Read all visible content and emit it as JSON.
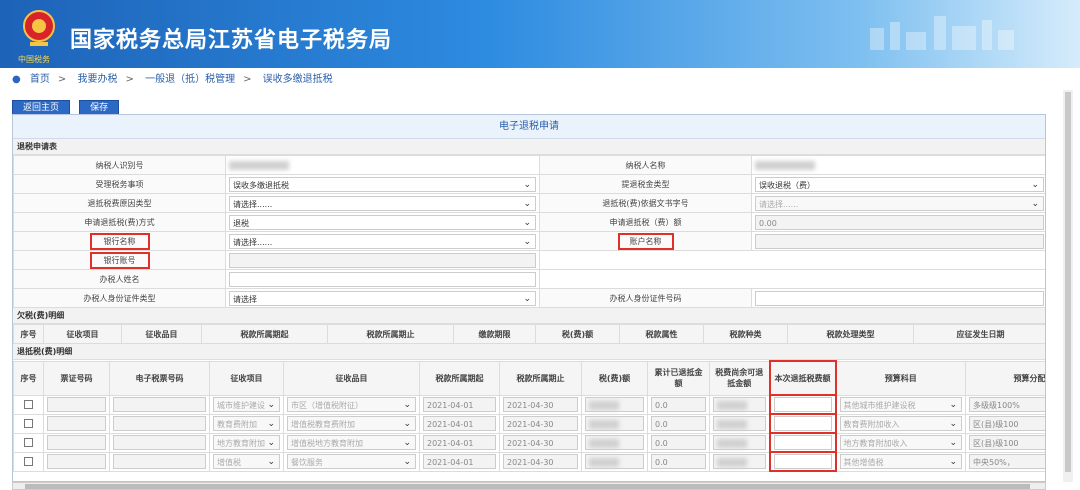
{
  "header": {
    "title": "国家税务总局江苏省电子税务局",
    "tagline": "中国税务"
  },
  "breadcrumb": [
    "首页",
    "我要办税",
    "一般退（抵）税管理",
    "误收多缴退抵税"
  ],
  "toolbar": {
    "back_label": "返回主页",
    "save_label": "保存"
  },
  "panel_title": "电子退税申请",
  "sections": {
    "apply": "退税申请表",
    "owed": "欠税(费)明细",
    "refund": "退抵税(费)明细"
  },
  "form": {
    "taxpayer_id_label": "纳税人识别号",
    "taxpayer_name_label": "纳税人名称",
    "matter_label": "受理税务事项",
    "matter_value": "误收多缴退抵税",
    "fund_type_label": "提退税金类型",
    "fund_type_value": "误收退税（费）",
    "reason_label": "退抵税费原因类型",
    "reason_value": "请选择......",
    "doc_no_label": "退抵税(费)依据文书字号",
    "doc_no_value": "请选择......",
    "method_label": "申请退抵税(费)方式",
    "method_value": "退税",
    "amount_label": "申请退抵税（费）额",
    "amount_value": "0.00",
    "bank_name_label": "银行名称",
    "bank_name_value": "请选择......",
    "account_name_label": "账户名称",
    "bank_account_label": "银行账号",
    "agent_name_label": "办税人姓名",
    "agent_idtype_label": "办税人身份证件类型",
    "agent_idtype_value": "请选择",
    "agent_idno_label": "办税人身份证件号码"
  },
  "owed_columns": [
    "序号",
    "征收项目",
    "征收品目",
    "税款所属期起",
    "税款所属期止",
    "缴款期限",
    "税(费)额",
    "税款属性",
    "税款种类",
    "税款处理类型",
    "应征发生日期"
  ],
  "refund_columns": [
    "序号",
    "票证号码",
    "电子税票号码",
    "征收项目",
    "征收品目",
    "税款所属期起",
    "税款所属期止",
    "税(费)额",
    "累计已退抵金额",
    "税费尚余可退抵金额",
    "本次退抵税费额",
    "预算科目",
    "预算分配"
  ],
  "refund_rows": [
    {
      "item": "城市维护建设",
      "subitem": "市区（增值税附征）",
      "start": "2021-04-01",
      "end": "2021-04-30",
      "refunded": "0.0",
      "budget": "其他城市维护建设税",
      "alloc": "多级级100%"
    },
    {
      "item": "教育费附加",
      "subitem": "增值税教育费附加",
      "start": "2021-04-01",
      "end": "2021-04-30",
      "refunded": "0.0",
      "budget": "教育费附加收入",
      "alloc": "区(县)级100"
    },
    {
      "item": "地方教育附加",
      "subitem": "增值税地方教育附加",
      "start": "2021-04-01",
      "end": "2021-04-30",
      "refunded": "0.0",
      "budget": "地方教育附加收入",
      "alloc": "区(县)级100"
    },
    {
      "item": "增值税",
      "subitem": "餐饮服务",
      "start": "2021-04-01",
      "end": "2021-04-30",
      "refunded": "0.0",
      "budget": "其他增值税",
      "alloc": "中央50%，"
    }
  ],
  "colors": {
    "header_blue": "#1d63b8",
    "highlight_red": "#e0302a",
    "button_blue": "#2c69c4"
  }
}
